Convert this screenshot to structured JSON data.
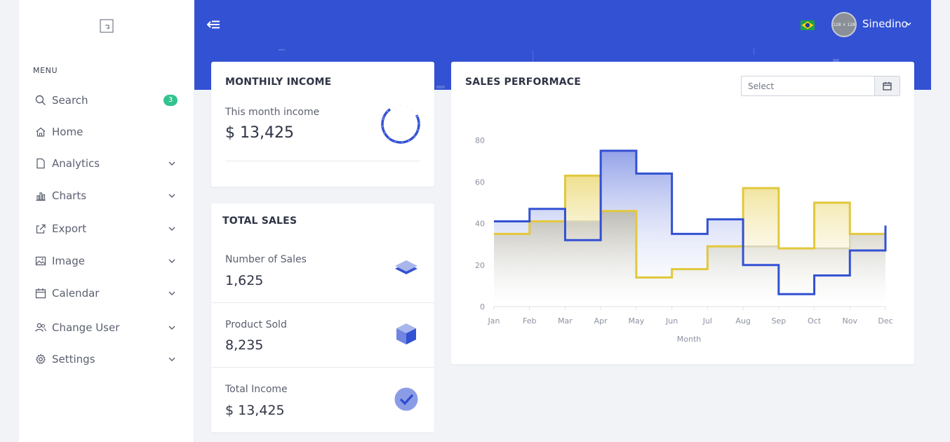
{
  "sidebar": {
    "menu_heading": "MENU",
    "search_badge": "3",
    "items": [
      {
        "label": "Search",
        "icon": "search-icon",
        "has_chevron": false
      },
      {
        "label": "Home",
        "icon": "home-icon",
        "has_chevron": false
      },
      {
        "label": "Analytics",
        "icon": "document-icon",
        "has_chevron": true
      },
      {
        "label": "Charts",
        "icon": "bar-chart-icon",
        "has_chevron": true
      },
      {
        "label": "Export",
        "icon": "share-icon",
        "has_chevron": true
      },
      {
        "label": "Image",
        "icon": "image-icon",
        "has_chevron": true
      },
      {
        "label": "Calendar",
        "icon": "calendar-icon",
        "has_chevron": true
      },
      {
        "label": "Change User",
        "icon": "users-icon",
        "has_chevron": true
      },
      {
        "label": "Settings",
        "icon": "gear-icon",
        "has_chevron": true
      }
    ]
  },
  "header": {
    "user_name": "Sinedino",
    "avatar_text": "128 × 128",
    "language_flag": "brazil-flag-icon"
  },
  "monthly_income": {
    "title": "MONTHILY INCOME",
    "label": "This month income",
    "value": "$ 13,425"
  },
  "total_sales": {
    "title": "TOTAL SALES",
    "rows": [
      {
        "label": "Number of Sales",
        "value": "1,625",
        "icon": "layers-icon"
      },
      {
        "label": "Product Sold",
        "value": "8,235",
        "icon": "cube-icon"
      },
      {
        "label": "Total Income",
        "value": "$ 13,425",
        "icon": "check-circle-icon"
      }
    ]
  },
  "sales_performance": {
    "title": "SALES PERFORMACE",
    "select_placeholder": "Select"
  },
  "colors": {
    "primary": "#3351d3",
    "series_blue": "#3351d3",
    "series_yellow": "#e2c83c",
    "series_gray": "#d9d4b4",
    "badge": "#34c38f"
  },
  "chart_data": {
    "type": "line",
    "step": true,
    "xlabel": "Month",
    "ylabel": "",
    "ylim": [
      0,
      80
    ],
    "yticks": [
      0,
      20,
      40,
      60,
      80
    ],
    "categories": [
      "Jan",
      "Feb",
      "Mar",
      "Apr",
      "May",
      "Jun",
      "Jul",
      "Aug",
      "Sep",
      "Oct",
      "Nov",
      "Dec"
    ],
    "series": [
      {
        "values": [
          41,
          47,
          32,
          75,
          64,
          35,
          42,
          20,
          6,
          15,
          27,
          39
        ]
      },
      {
        "values": [
          35,
          41,
          63,
          46,
          14,
          18,
          29,
          57,
          28,
          50,
          35,
          35
        ]
      },
      {
        "values": [
          35,
          41,
          41,
          46,
          14,
          18,
          29,
          29,
          28,
          28,
          35,
          35
        ]
      }
    ],
    "grid": false,
    "legend": "none"
  }
}
